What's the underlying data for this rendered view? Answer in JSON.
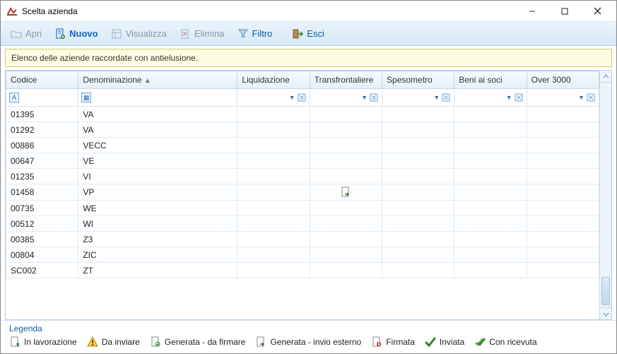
{
  "window": {
    "title": "Scelta azienda"
  },
  "toolbar": {
    "apri": "Apri",
    "nuovo": "Nuovo",
    "visualizza": "Visualizza",
    "elimina": "Elimina",
    "filtro": "Filtro",
    "esci": "Esci"
  },
  "banner": {
    "text": "Elenco delle aziende raccordate con antielusione."
  },
  "grid": {
    "columns": {
      "codice": "Codice",
      "denominazione": "Denominazione",
      "liquidazione": "Liquidazione",
      "transfrontaliere": "Transfrontaliere",
      "spesometro": "Spesometro",
      "beniaisoci": "Beni ai soci",
      "over3000": "Over 3000"
    },
    "rows": [
      {
        "codice": "01395",
        "denom": "VA",
        "transf_icon": ""
      },
      {
        "codice": "01292",
        "denom": "VA",
        "transf_icon": ""
      },
      {
        "codice": "00886",
        "denom": "VECC",
        "transf_icon": ""
      },
      {
        "codice": "00647",
        "denom": "VE",
        "transf_icon": ""
      },
      {
        "codice": "01235",
        "denom": "VI",
        "transf_icon": ""
      },
      {
        "codice": "01458",
        "denom": "VP",
        "transf_icon": "generata-invio-esterno"
      },
      {
        "codice": "00735",
        "denom": "WE",
        "transf_icon": ""
      },
      {
        "codice": "00512",
        "denom": "WI",
        "transf_icon": ""
      },
      {
        "codice": "00385",
        "denom": "Z3",
        "transf_icon": ""
      },
      {
        "codice": "00804",
        "denom": "ZIC",
        "transf_icon": ""
      },
      {
        "codice": "SC002",
        "denom": "ZT",
        "transf_icon": ""
      }
    ]
  },
  "legend": {
    "title": "Legenda",
    "items": {
      "in_lavorazione": "In lavorazione",
      "da_inviare": "Da inviare",
      "generata_da_firmare": "Generata - da firmare",
      "generata_invio_esterno": "Generata - invio esterno",
      "firmata": "Firmata",
      "inviata": "Inviata",
      "con_ricevuta": "Con ricevuta"
    }
  }
}
